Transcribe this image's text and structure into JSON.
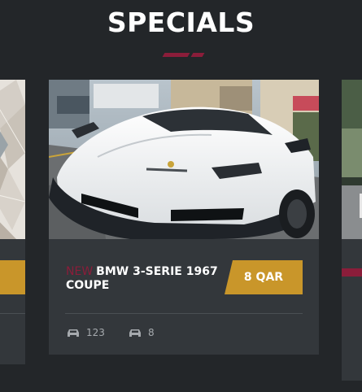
{
  "section": {
    "title": "SPECIALS"
  },
  "colors": {
    "background": "#232629",
    "card": "#33373b",
    "accent": "#8b1d3a",
    "price": "#c9962a"
  },
  "cards": [
    {
      "badge": "NEW",
      "title": "BMW 3-SERIE 1967 COUPE",
      "price": "8 QAR",
      "meta": [
        {
          "icon": "car-icon",
          "value": "123"
        },
        {
          "icon": "car-icon",
          "value": "8"
        }
      ]
    }
  ]
}
